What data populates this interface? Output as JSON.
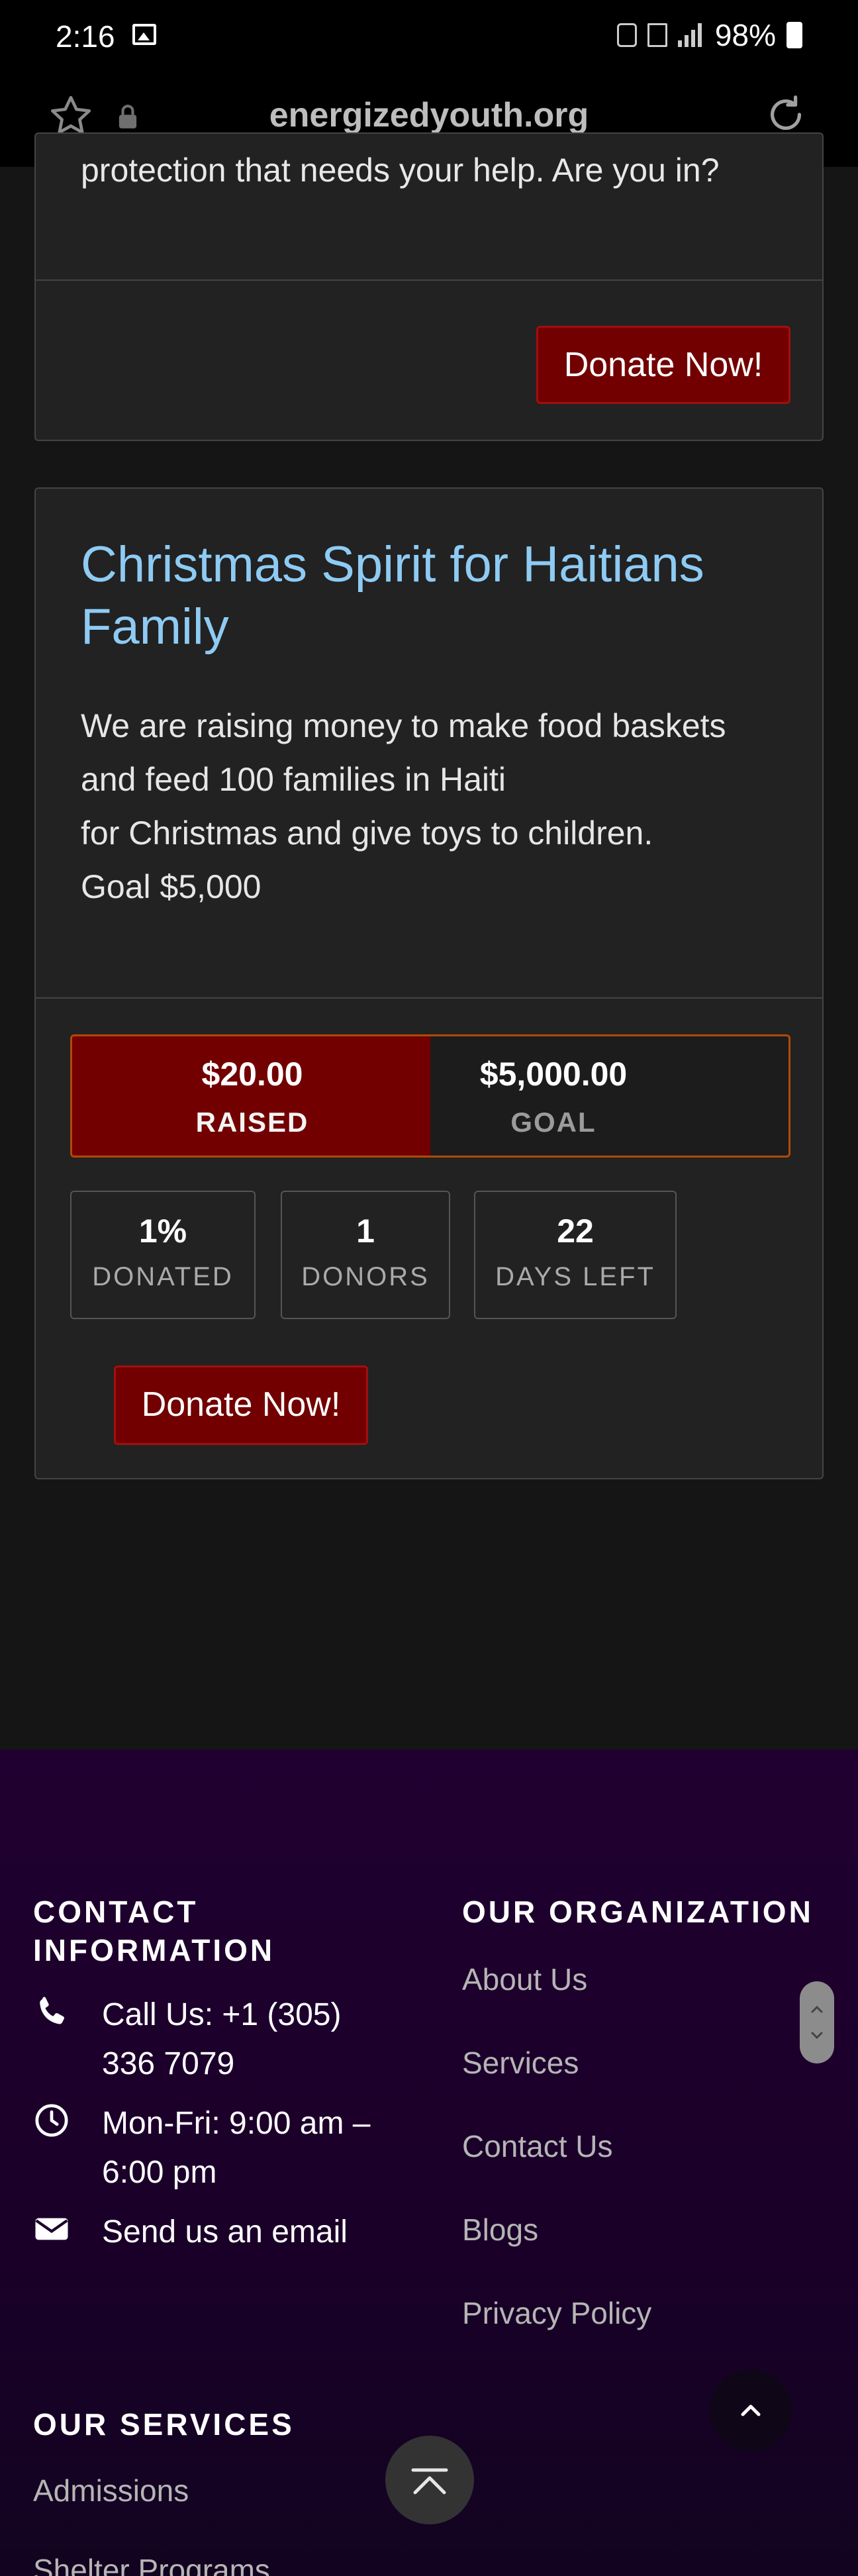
{
  "status_bar": {
    "time": "2:16",
    "battery": "98%"
  },
  "browser": {
    "url": "energizedyouth.org"
  },
  "card1": {
    "text_tail": "protection that needs your help. Are you in?",
    "donate_label": "Donate Now!"
  },
  "card2": {
    "title": "Christmas Spirit for Haitians Family",
    "description_lines": [
      "We are raising money to make food baskets",
      "and feed 100 families in Haiti",
      "for Christmas and give toys to children.",
      "Goal $5,000"
    ],
    "raised_amount": "$20.00",
    "raised_label": "RAISED",
    "goal_amount": "$5,000.00",
    "goal_label": "GOAL",
    "progress_fraction": 0.004,
    "stats": [
      {
        "value": "1%",
        "label": "DONATED"
      },
      {
        "value": "1",
        "label": "DONORS"
      },
      {
        "value": "22",
        "label": "DAYS LEFT"
      }
    ],
    "donate_label": "Donate Now!"
  },
  "footer": {
    "contact_heading": "CONTACT INFORMATION",
    "contact": [
      {
        "icon": "phone-icon",
        "text": "Call Us: +1 (305) 336 7079"
      },
      {
        "icon": "clock-icon",
        "text": "Mon-Fri: 9:00 am – 6:00 pm"
      },
      {
        "icon": "envelope-icon",
        "text": "Send us an email"
      }
    ],
    "org_heading": "OUR ORGANIZATION",
    "org_links": [
      "About Us",
      "Services",
      "Contact Us",
      "Blogs",
      "Privacy Policy"
    ],
    "services_heading": "OUR SERVICES",
    "service_links": [
      "Admissions",
      "Shelter Programs"
    ]
  },
  "colors": {
    "accent_red": "#720000",
    "title_blue": "#8ecbf4",
    "footer_purple": "#200030"
  }
}
